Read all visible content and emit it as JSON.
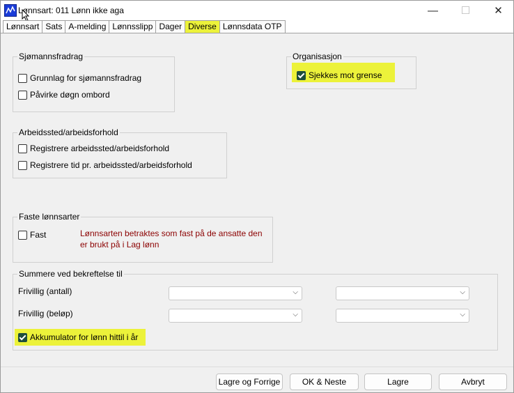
{
  "window": {
    "title": "Lønnsart: 011 Lønn ikke aga"
  },
  "tabs": [
    "Lønnsart",
    "Sats",
    "A-melding",
    "Lønnsslipp",
    "Dager",
    "Diverse",
    "Lønnsdata OTP"
  ],
  "active_tab": "Diverse",
  "sjomann": {
    "title": "Sjømannsfradrag",
    "grunnlag": "Grunnlag for sjømannsfradrag",
    "pavirke": "Påvirke døgn ombord"
  },
  "organisasjon": {
    "title": "Organisasjon",
    "sjekkes": "Sjekkes mot grense"
  },
  "arbeidssted": {
    "title": "Arbeidssted/arbeidsforhold",
    "registrere": "Registrere arbeidssted/arbeidsforhold",
    "registrere_tid": "Registrere tid pr. arbeidssted/arbeidsforhold"
  },
  "faste": {
    "title": "Faste lønnsarter",
    "fast": "Fast",
    "note": "Lønnsarten betraktes som fast på de ansatte den er brukt på i Lag lønn"
  },
  "summere": {
    "title": "Summere ved bekreftelse til",
    "frivillig_antall": "Frivillig (antall)",
    "frivillig_belop": "Frivillig (beløp)",
    "akkumuler": "Akkumulator for lønn hittil i år"
  },
  "buttons": {
    "lagre_forrige": "Lagre og Forrige",
    "ok_neste": "OK & Neste",
    "lagre": "Lagre",
    "avbryt": "Avbryt"
  },
  "colors": {
    "highlight": "#ecf23a",
    "checked": "#1d4d3b",
    "note": "#8b0000"
  },
  "icons": {
    "app": "app-icon",
    "minimize": "minimize-icon",
    "maximize": "maximize-icon",
    "close": "close-icon",
    "dropdown": "chevron-down-icon"
  }
}
